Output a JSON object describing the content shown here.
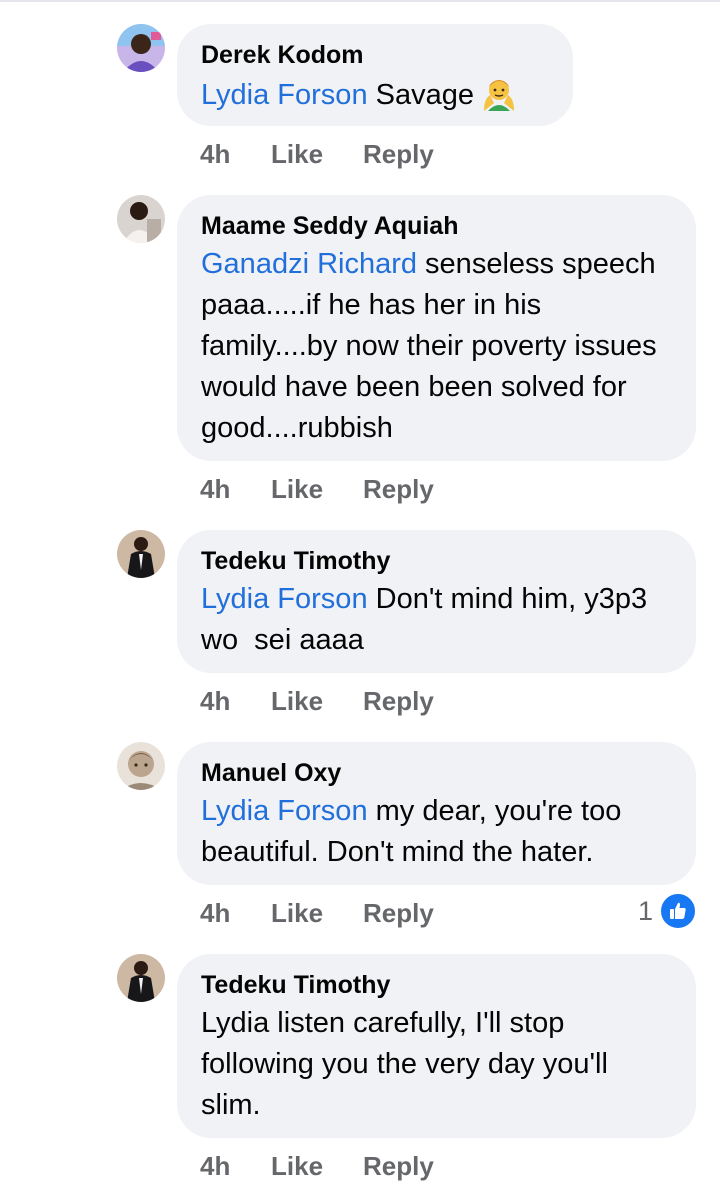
{
  "comments": [
    {
      "author": "Derek Kodom",
      "mention": "Lydia Forson",
      "text": " Savage",
      "emoji": "person-gesturing-no-emoji",
      "time": "4h",
      "like_label": "Like",
      "reply_label": "Reply"
    },
    {
      "author": "Maame Seddy Aquiah",
      "mention": "Ganadzi Richard",
      "text": " senseless speech paaa.....if he has her in his family....by now their poverty issues would have been been solved for good....rubbish",
      "time": "4h",
      "like_label": "Like",
      "reply_label": "Reply"
    },
    {
      "author": "Tedeku Timothy",
      "mention": "Lydia Forson",
      "text": " Don't mind him, y3p3 wo  sei aaaa",
      "time": "4h",
      "like_label": "Like",
      "reply_label": "Reply"
    },
    {
      "author": "Manuel Oxy",
      "mention": "Lydia Forson",
      "text": " my dear, you're too beautiful. Don't mind the hater.",
      "time": "4h",
      "like_label": "Like",
      "reply_label": "Reply",
      "reaction_count": "1",
      "reaction_icon": "thumbs-up-icon"
    },
    {
      "author": "Tedeku Timothy",
      "mention": "",
      "text": "Lydia listen carefully, I'll stop following you the very day you'll slim.",
      "time": "4h",
      "like_label": "Like",
      "reply_label": "Reply"
    }
  ],
  "colors": {
    "mention": "#216fdb",
    "bubble": "#f0f2f5",
    "meta": "#65676b",
    "like_badge": "#1877f2"
  }
}
